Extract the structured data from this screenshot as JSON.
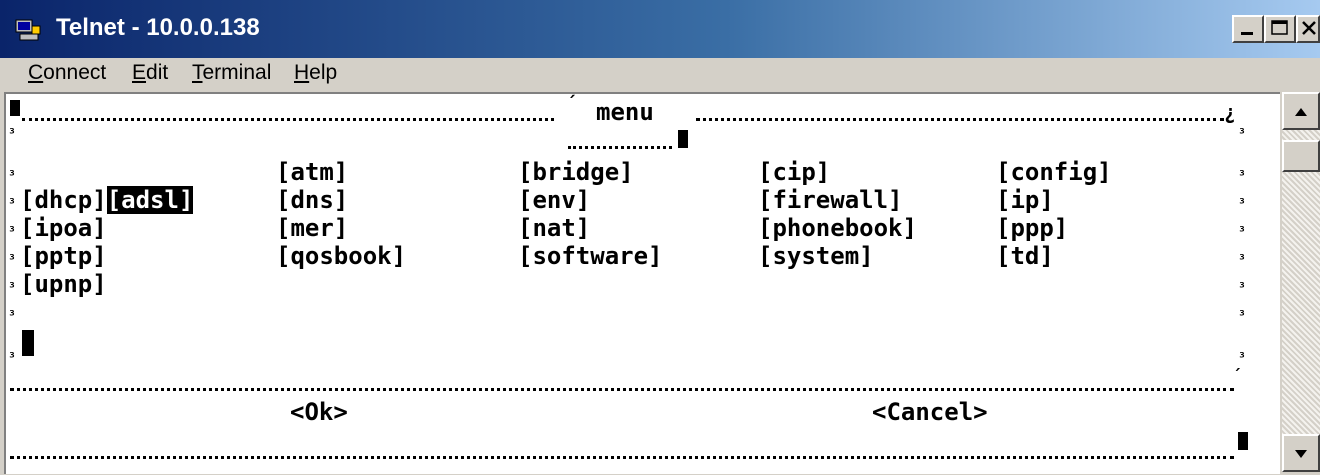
{
  "window": {
    "title": "Telnet - 10.0.0.138"
  },
  "menubar": [
    {
      "label": "Connect",
      "accel": "C"
    },
    {
      "label": "Edit",
      "accel": "E"
    },
    {
      "label": "Terminal",
      "accel": "T"
    },
    {
      "label": "Help",
      "accel": "H"
    }
  ],
  "terminal": {
    "menu_title": "menu",
    "items": [
      [
        "[adsl]",
        "[atm]",
        "[bridge]",
        "[cip]",
        "[config]"
      ],
      [
        "[dhcp]",
        "[dns]",
        "[env]",
        "[firewall]",
        "[ip]"
      ],
      [
        "[ipoa]",
        "[mer]",
        "[nat]",
        "[phonebook]",
        "[ppp]"
      ],
      [
        "[pptp]",
        "[qosbook]",
        "[software]",
        "[system]",
        "[td]"
      ],
      [
        "[upnp]"
      ]
    ],
    "selected_item": "[adsl]",
    "ok_button": "<Ok>",
    "cancel_button": "<Cancel>"
  },
  "icons": {
    "window_icon": "telnet-computer-icon",
    "minimize": "minimize-icon",
    "maximize": "maximize-icon",
    "close": "close-icon",
    "scroll_up": "arrow-up-icon",
    "scroll_down": "arrow-down-icon"
  },
  "colors": {
    "title_active": "#0a246a",
    "title_fade": "#a6caf0",
    "chrome": "#d4d0c8",
    "terminal_bg": "#ffffff",
    "terminal_fg": "#000000"
  }
}
